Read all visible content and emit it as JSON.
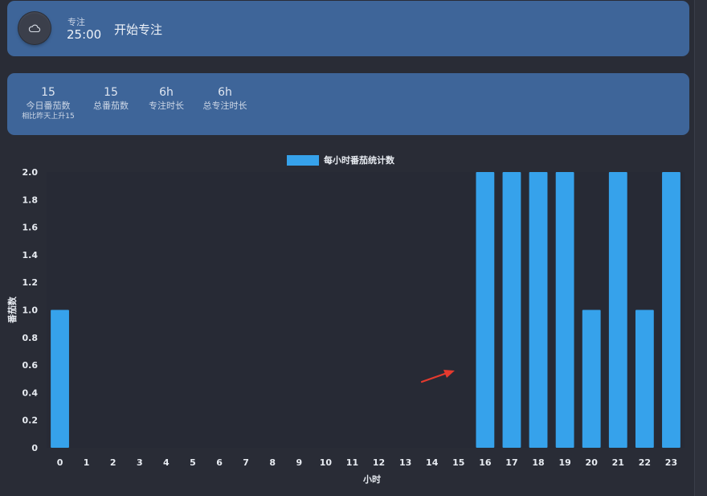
{
  "focus": {
    "label": "专注",
    "time": "25:00",
    "start_label": "开始专注",
    "button_icon": "cloud-icon"
  },
  "stats": [
    {
      "value": "15",
      "label": "今日番茄数",
      "sub": "相比昨天上升15"
    },
    {
      "value": "15",
      "label": "总番茄数"
    },
    {
      "value": "6h",
      "label": "专注时长"
    },
    {
      "value": "6h",
      "label": "总专注时长"
    }
  ],
  "colors": {
    "bar": "#36a2eb",
    "card": "#3e6599",
    "background": "#292c36",
    "plot_background": "#272a35",
    "arrow": "#e53a2e"
  },
  "chart_data": {
    "type": "bar",
    "title": "",
    "xlabel": "小时",
    "ylabel": "番茄数",
    "categories": [
      "0",
      "1",
      "2",
      "3",
      "4",
      "5",
      "6",
      "7",
      "8",
      "9",
      "10",
      "11",
      "12",
      "13",
      "14",
      "15",
      "16",
      "17",
      "18",
      "19",
      "20",
      "21",
      "22",
      "23"
    ],
    "series": [
      {
        "name": "每小时番茄统计数",
        "values": [
          1,
          0,
          0,
          0,
          0,
          0,
          0,
          0,
          0,
          0,
          0,
          0,
          0,
          0,
          0,
          0,
          2,
          2,
          2,
          2,
          1,
          2,
          1,
          2
        ]
      }
    ],
    "y_ticks": [
      "0",
      "0.2",
      "0.4",
      "0.6",
      "0.8",
      "1.0",
      "1.2",
      "1.4",
      "1.6",
      "1.8",
      "2.0"
    ],
    "ylim": [
      0,
      2
    ],
    "grid": false,
    "legend_position": "top-center"
  }
}
